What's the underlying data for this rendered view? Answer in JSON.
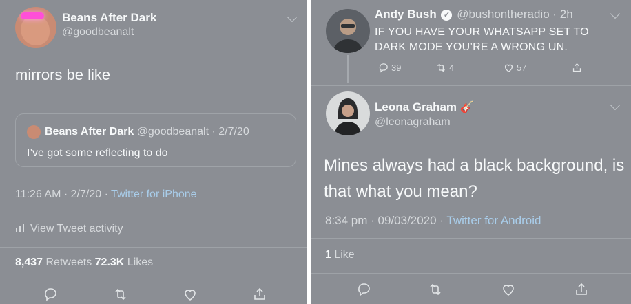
{
  "left_tweet": {
    "author_name": "Beans After Dark",
    "author_handle": "@goodbeanalt",
    "text": "mirrors be like",
    "quote": {
      "author_name": "Beans After Dark",
      "author_handle_date": "@goodbeanalt · 2/7/20",
      "text": "I’ve got some reflecting to do"
    },
    "time_date": "11:26 AM · 2/7/20 · ",
    "source": "Twitter for iPhone",
    "activity_label": "View Tweet activity",
    "retweets_count": "8,437",
    "retweets_label": " Retweets ",
    "likes_count": "72.3K",
    "likes_label": " Likes",
    "icons": [
      "reply-icon",
      "retweet-icon",
      "like-icon",
      "share-icon"
    ]
  },
  "right_reply_parent": {
    "author_name": "Andy Bush",
    "author_handle_time": " @bushontheradio · 2h",
    "text": "IF YOU HAVE YOUR WHATSAPP SET TO DARK MODE YOU’RE A WRONG UN.",
    "reply_count": "39",
    "retweet_count": "4",
    "like_count": "57"
  },
  "right_reply": {
    "author_name": "Leona Graham",
    "author_emoji": "🎸",
    "author_handle": "@leonagraham",
    "text": "Mines always had a black background, is that what you mean?",
    "time_date": "8:34 pm · 09/03/2020 · ",
    "source": "Twitter for Android",
    "likes_count": "1",
    "likes_label": " Like"
  },
  "colors": {
    "background": "#8b8e94",
    "link": "#a9cdea",
    "text": "#f7f9fa",
    "muted": "#d7dadd"
  }
}
